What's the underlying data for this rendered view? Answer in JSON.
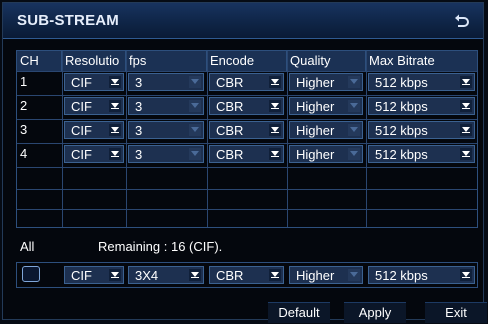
{
  "window": {
    "title": "SUB-STREAM"
  },
  "headers": [
    "CH",
    "Resolutio",
    "fps",
    "Encode",
    "Quality",
    "Max Bitrate"
  ],
  "rows": [
    {
      "ch": "1",
      "resolution": "CIF",
      "fps": "3",
      "encode": "CBR",
      "quality": "Higher",
      "bitrate": "512 kbps"
    },
    {
      "ch": "2",
      "resolution": "CIF",
      "fps": "3",
      "encode": "CBR",
      "quality": "Higher",
      "bitrate": "512 kbps"
    },
    {
      "ch": "3",
      "resolution": "CIF",
      "fps": "3",
      "encode": "CBR",
      "quality": "Higher",
      "bitrate": "512 kbps"
    },
    {
      "ch": "4",
      "resolution": "CIF",
      "fps": "3",
      "encode": "CBR",
      "quality": "Higher",
      "bitrate": "512 kbps"
    }
  ],
  "all": {
    "label": "All",
    "remaining": "Remaining : 16 (CIF).",
    "resolution": "CIF",
    "fps": "3X4",
    "encode": "CBR",
    "quality": "Higher",
    "bitrate": "512 kbps"
  },
  "buttons": {
    "default": "Default",
    "apply": "Apply",
    "exit": "Exit"
  },
  "colors": {
    "titlebar": "#0f2547",
    "cell": "#1d3050",
    "header": "#1b3154",
    "border": "#3b6190"
  }
}
